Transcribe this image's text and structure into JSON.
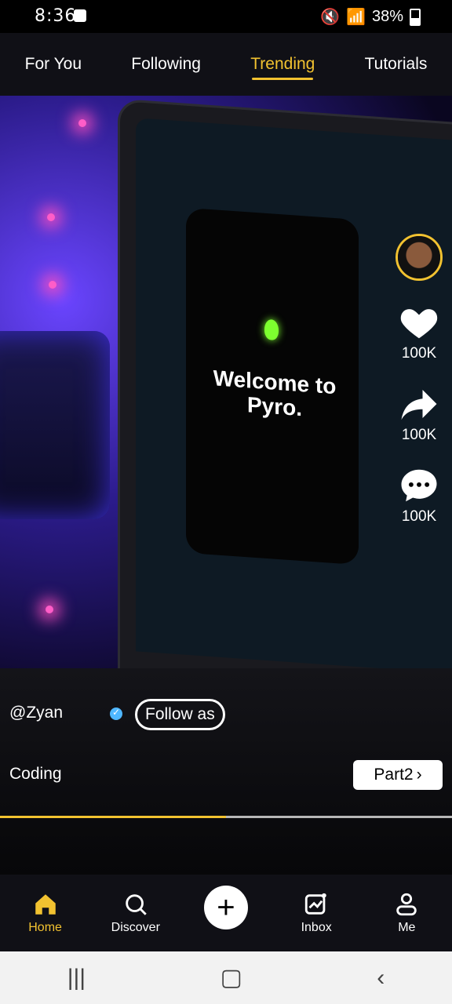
{
  "status_bar": {
    "time": "8:36",
    "battery_text": "38%",
    "icons": [
      "shopping-bag-icon",
      "mute-icon",
      "wifi-icon",
      "signal-icon",
      "signal-icon",
      "battery-icon"
    ]
  },
  "tabs": [
    {
      "label": "For You",
      "active": false
    },
    {
      "label": "Following",
      "active": false
    },
    {
      "label": "Trending",
      "active": true
    },
    {
      "label": "Tutorials",
      "active": false
    }
  ],
  "video": {
    "on_screen_text": "Welcome to Pyro.",
    "author": "@Zyan",
    "follow_label": "Follow as",
    "description": "Coding",
    "part_label": "Part2",
    "progress_fraction": 0.5
  },
  "side_actions": [
    {
      "name": "like",
      "count": "100K"
    },
    {
      "name": "share",
      "count": "100K"
    },
    {
      "name": "comment",
      "count": "100K"
    }
  ],
  "bottom_nav": [
    {
      "label": "Home",
      "icon": "home-icon",
      "active": true
    },
    {
      "label": "Discover",
      "icon": "search-icon",
      "active": false
    },
    {
      "label": "",
      "icon": "plus-icon",
      "active": false
    },
    {
      "label": "Inbox",
      "icon": "inbox-icon",
      "active": false
    },
    {
      "label": "Me",
      "icon": "user-icon",
      "active": false
    }
  ],
  "colors": {
    "accent": "#f2c230",
    "nav_bg": "#101016"
  }
}
